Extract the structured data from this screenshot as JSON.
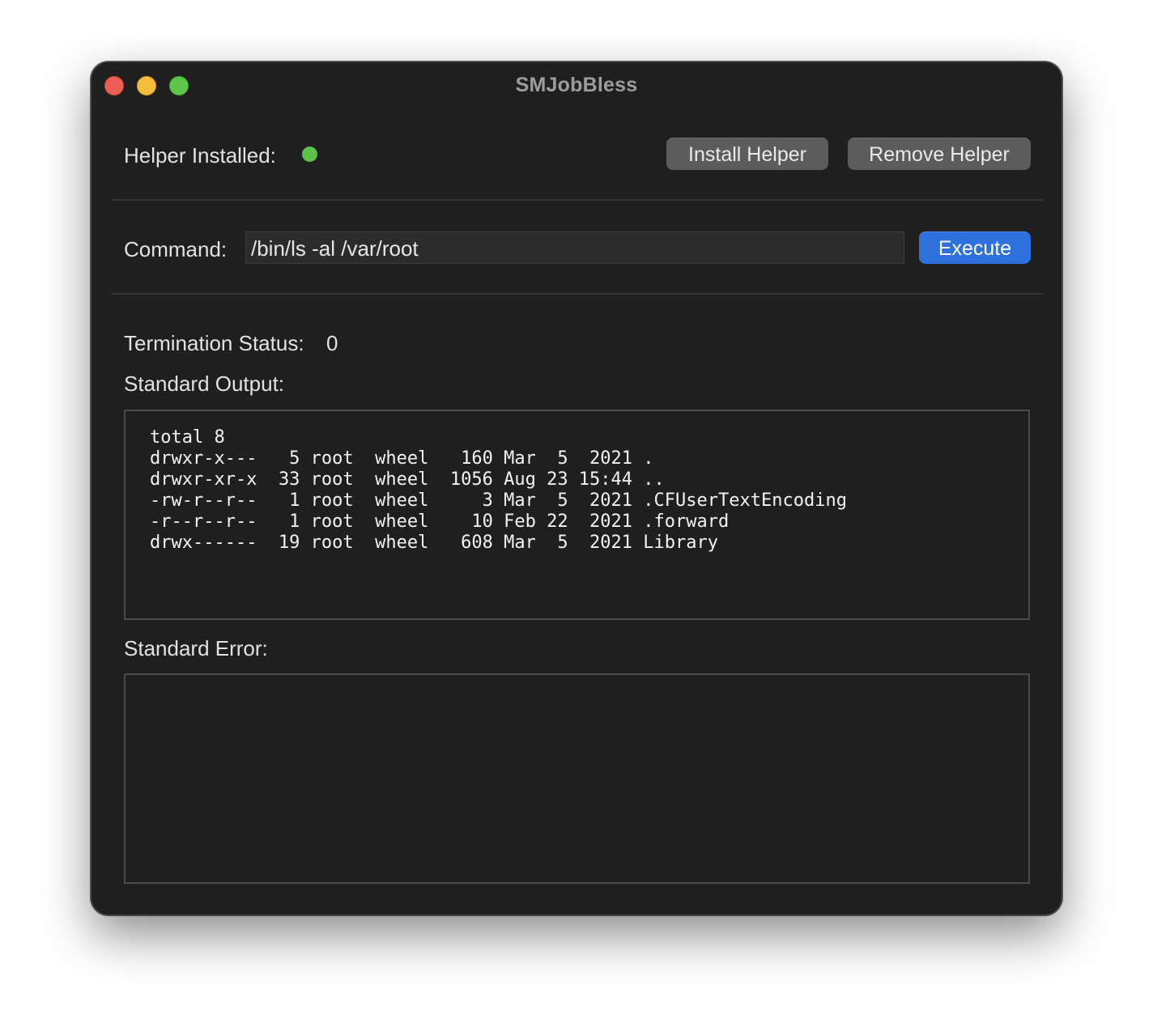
{
  "window": {
    "title": "SMJobBless"
  },
  "helper": {
    "installed_label": "Helper Installed:",
    "status": "installed",
    "status_color": "#5cc247",
    "install_button": "Install Helper",
    "remove_button": "Remove Helper"
  },
  "command": {
    "label": "Command:",
    "value": "/bin/ls -al /var/root",
    "execute_button": "Execute"
  },
  "result": {
    "termination_label": "Termination Status:",
    "termination_value": "0",
    "stdout_label": "Standard Output:",
    "stdout_lines": [
      "total 8",
      "drwxr-x---   5 root  wheel   160 Mar  5  2021 .",
      "drwxr-xr-x  33 root  wheel  1056 Aug 23 15:44 ..",
      "-rw-r--r--   1 root  wheel     3 Mar  5  2021 .CFUserTextEncoding",
      "-r--r--r--   1 root  wheel    10 Feb 22  2021 .forward",
      "drwx------  19 root  wheel   608 Mar  5  2021 Library"
    ],
    "stderr_label": "Standard Error:",
    "stderr_text": ""
  },
  "colors": {
    "accent": "#2f71dc",
    "window_bg": "#1f1f1f"
  }
}
